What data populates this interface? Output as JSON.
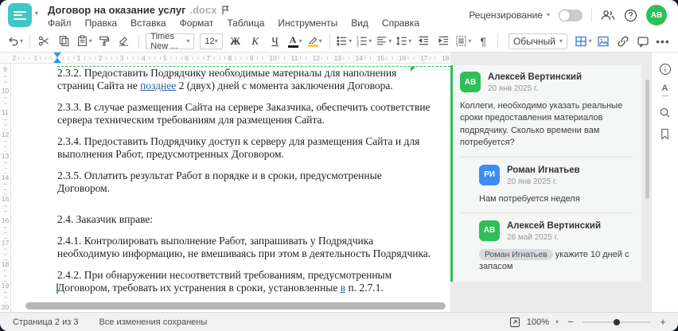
{
  "colors": {
    "accent_teal": "#41c7c3",
    "green": "#2fbf57",
    "blue": "#3d8df5",
    "toolbar_blue": "#4285cf",
    "ruler_marker": "#1e9be9",
    "highlight_yellow": "#f3cd45"
  },
  "header": {
    "title": "Договор на оказание услуг",
    "title_ext": ".docx",
    "menu": [
      "Файл",
      "Правка",
      "Вставка",
      "Формат",
      "Таблица",
      "Инструменты",
      "Вид",
      "Справка"
    ],
    "review_label": "Рецензирование",
    "avatar_initials": "АВ"
  },
  "toolbar": {
    "font_name": "Times New ...",
    "font_size": "12",
    "bold_label": "Ж",
    "italic_label": "К",
    "underline_label": "Ч",
    "font_color_label": "А",
    "style_name": "Обычный",
    "pilcrow": "¶",
    "more_label": "•••"
  },
  "ruler": {
    "h_pre_numbers": [
      "1",
      "2"
    ],
    "h_numbers": [
      "1",
      "2",
      "3",
      "4",
      "5",
      "6",
      "7",
      "8",
      "9",
      "10",
      "11",
      "12",
      "13",
      "14",
      "15",
      "16",
      "17",
      "18"
    ],
    "v_numbers": [
      "9",
      "10",
      "11",
      "12",
      "13",
      "14",
      "15",
      "16",
      "17",
      "18",
      "19",
      "20"
    ]
  },
  "document": {
    "paragraphs": [
      {
        "segments": [
          {
            "t": "2.3.2. Предоставить Подрядчику необходимые материалы для наполнения страниц Сайта не "
          },
          {
            "t": "позднее",
            "ins": true
          },
          {
            "t": " 2 (двух) дней с момента заключения Договора."
          }
        ]
      },
      {
        "segments": [
          {
            "t": "2.3.3. В случае размещения Сайта на сервере Заказчика, обеспечить соответствие сервера техническим требованиям для размещения Сайта."
          }
        ]
      },
      {
        "segments": [
          {
            "t": "2.3.4. Предоставить Подрядчику доступ к серверу для размещения Сайта и для выполнения Работ, предусмотренных Договором."
          }
        ]
      },
      {
        "segments": [
          {
            "t": "2.3.5. Оплатить результат Работ в порядке и в сроки, предусмотренные Договором."
          }
        ]
      },
      {
        "gap_before": true,
        "segments": [
          {
            "t": "2.4. Заказчик вправе:"
          }
        ]
      },
      {
        "segments": [
          {
            "t": "2.4.1. Контролировать выполнение Работ, запрашивать у Подрядчика необходимую информацию, не вмешиваясь при этом в деятельность Подрядчика."
          }
        ]
      },
      {
        "segments": [
          {
            "t": "2.4.2. При обнаружении несоответствий требованиям, предусмотренным Договором, требовать их устранения в сроки, установленные "
          },
          {
            "t": "в",
            "ins": true
          },
          {
            "t": " п. 2.7.1."
          }
        ]
      }
    ]
  },
  "comments": {
    "items": [
      {
        "initials": "АВ",
        "color": "#2fbf57",
        "name": "Алексей Вертинский",
        "date": "20 янв 2025 г.",
        "text": "Коллеги, необходимо указать реальные сроки предоставления материалов подрядчику. Сколько времени вам потребуется?",
        "reply": false
      },
      {
        "initials": "РИ",
        "color": "#3d8df5",
        "name": "Роман Игнатьев",
        "date": "20 янв 2025 г.",
        "text": "Нам потребуется неделя",
        "reply": true
      },
      {
        "initials": "АВ",
        "color": "#2fbf57",
        "name": "Алексей Вертинский",
        "date": "26 май 2025 г.",
        "mention": "Роман Игнатьев",
        "text": " укажите 10 дней с запасом",
        "reply": true
      }
    ]
  },
  "side_icons": [
    "info-icon",
    "spellcheck-icon",
    "search-icon",
    "bookmark-icon"
  ],
  "statusbar": {
    "page_label": "Страница 2 из 3",
    "saved_label": "Все изменения сохранены",
    "zoom_value": "100%",
    "zoom_minus": "−",
    "zoom_plus": "+"
  }
}
